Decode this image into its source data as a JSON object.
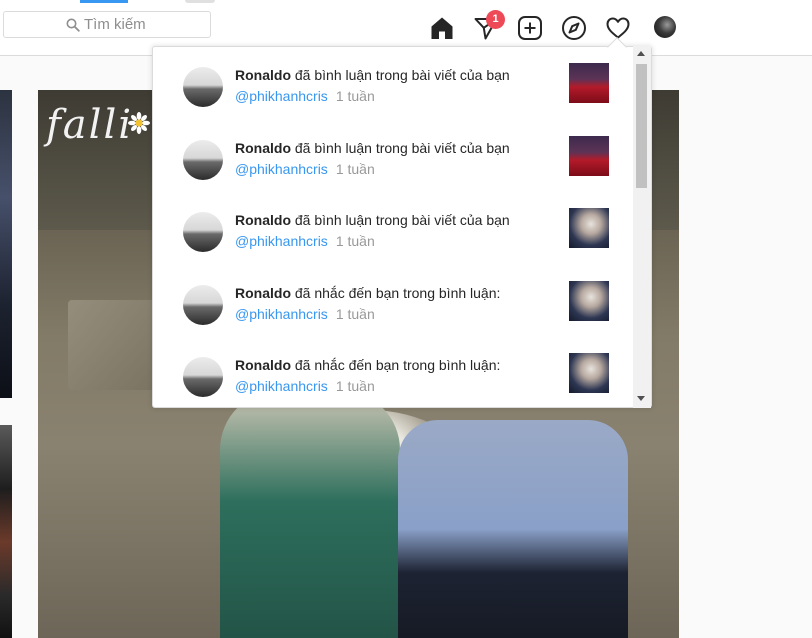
{
  "search": {
    "placeholder": "Tìm kiếm"
  },
  "nav": {
    "icons": [
      "home-icon",
      "direct-message-icon",
      "new-post-icon",
      "explore-icon",
      "activity-heart-icon",
      "profile-avatar"
    ],
    "direct_badge": "1"
  },
  "post": {
    "overlay_text": "falli"
  },
  "notifications": [
    {
      "user": "Ronaldo",
      "action": "đã bình luận trong bài viết của bạn",
      "handle": "@phikhanhcris",
      "time": "1 tuần",
      "thumb": "red"
    },
    {
      "user": "Ronaldo",
      "action": "đã bình luận trong bài viết của bạn",
      "handle": "@phikhanhcris",
      "time": "1 tuần",
      "thumb": "red"
    },
    {
      "user": "Ronaldo",
      "action": "đã bình luận trong bài viết của bạn",
      "handle": "@phikhanhcris",
      "time": "1 tuần",
      "thumb": "girl"
    },
    {
      "user": "Ronaldo",
      "action": "đã nhắc đến bạn trong bình luận:",
      "handle": "@phikhanhcris",
      "time": "1 tuần",
      "thumb": "girl"
    },
    {
      "user": "Ronaldo",
      "action": "đã nhắc đến bạn trong bình luận:",
      "handle": "@phikhanhcris",
      "time": "1 tuần",
      "thumb": "girl"
    }
  ],
  "colors": {
    "link": "#3897f0",
    "badge": "#ed4956",
    "time": "#999999",
    "border": "#dbdbdb"
  }
}
